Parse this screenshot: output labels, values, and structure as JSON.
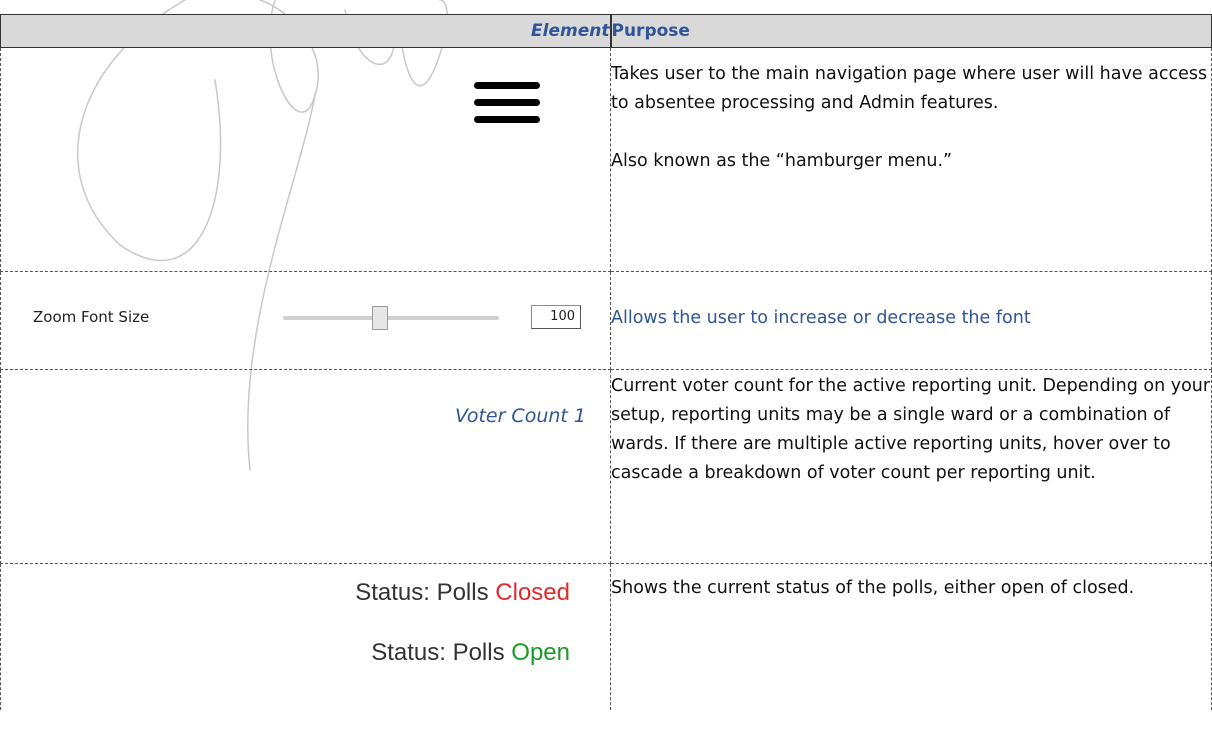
{
  "header": {
    "element": "Element",
    "purpose": "Purpose"
  },
  "rows": {
    "menu": {
      "purpose_1": "Takes user to the main navigation page where user will have access to absentee processing and Admin features.",
      "purpose_2": "Also known as the “hamburger menu.”"
    },
    "zoom": {
      "label": "Zoom Font Size",
      "value": "100",
      "slider_level": 0.45,
      "purpose": "Allows the user to increase or decrease the font"
    },
    "count": {
      "element": "Voter Count 1",
      "purpose": "Current voter count for the active reporting unit. Depending on your setup, reporting units may be a single ward or a combination of wards. If there are multiple active reporting units, hover over to cascade a breakdown of voter count per reporting unit."
    },
    "status": {
      "prefix": "Status: Polls",
      "closed": "Closed",
      "open": "Open",
      "purpose": "Shows the current status of the polls, either open of closed."
    }
  },
  "colors": {
    "header_text": "#2f5597",
    "header_bg": "#d9d9d9",
    "closed": "#e02b2b",
    "open": "#1c9b28"
  }
}
